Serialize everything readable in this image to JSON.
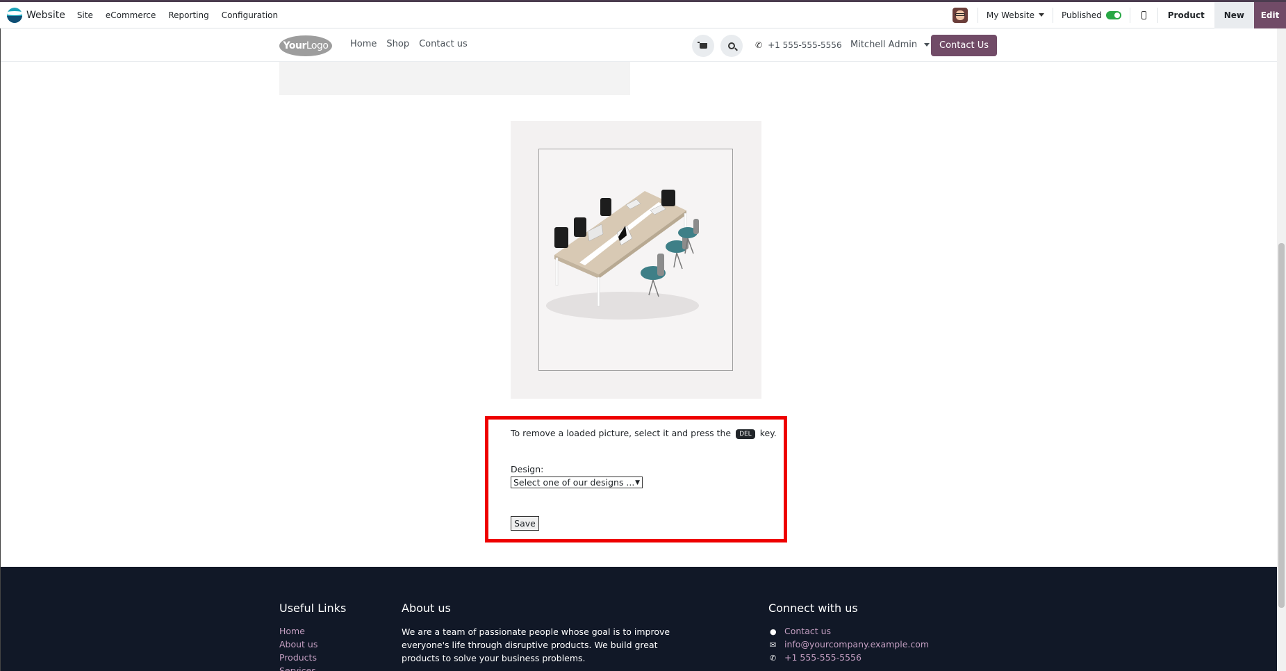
{
  "topbar": {
    "app_name": "Website",
    "menu": [
      "Site",
      "eCommerce",
      "Reporting",
      "Configuration"
    ],
    "website_selector": "My Website",
    "published_label": "Published",
    "published": true,
    "product_label": "Product",
    "new_label": "New",
    "edit_label": "Edit"
  },
  "site_header": {
    "logo_text_bold": "Your",
    "logo_text_light": "Logo",
    "nav": [
      "Home",
      "Shop",
      "Contact us"
    ],
    "phone": "+1 555-555-5556",
    "user": "Mitchell Admin",
    "contact_button": "Contact Us"
  },
  "form": {
    "remove_note_before": "To remove a loaded picture, select it and press the",
    "remove_key": "DEL",
    "remove_note_after": "key.",
    "design_label": "Design:",
    "design_select_value": "Select one of our designs ...",
    "save_label": "Save"
  },
  "footer": {
    "useful_links_title": "Useful Links",
    "useful_links": [
      "Home",
      "About us",
      "Products",
      "Services"
    ],
    "about_title": "About us",
    "about_text": "We are a team of passionate people whose goal is to improve everyone's life through disruptive products. We build great products to solve your business problems.",
    "connect_title": "Connect with us",
    "connect_items": [
      "Contact us",
      "info@yourcompany.example.com",
      "+1 555-555-5556"
    ]
  },
  "colors": {
    "brand": "#714b67",
    "highlight_border": "#ee0000",
    "footer_bg": "#111827",
    "footer_link": "#c49fc2"
  }
}
